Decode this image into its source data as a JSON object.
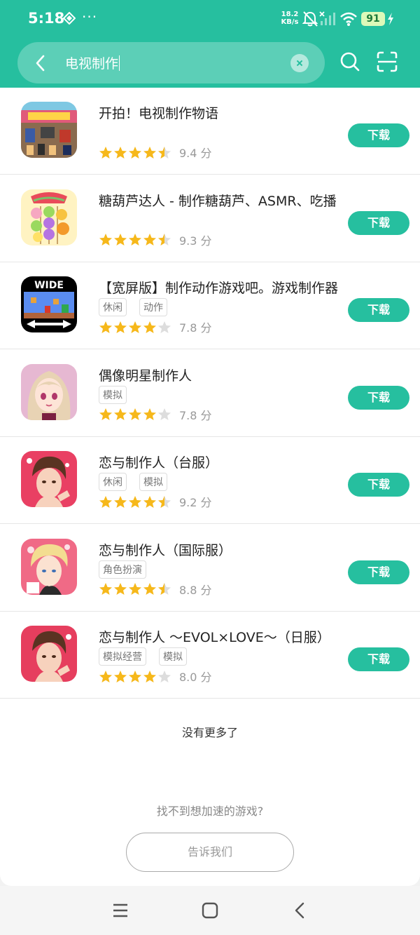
{
  "status_bar": {
    "time": "5:18",
    "dots": "···",
    "speed_value": "18.2",
    "speed_unit": "KB/s",
    "battery": "91"
  },
  "search": {
    "query": "电视制作"
  },
  "theme": {
    "accent": "#26bf9f",
    "star": "#f6b81b",
    "star_empty": "#dddddd"
  },
  "apps": [
    {
      "title": "开拍！电视制作物语",
      "tags": [],
      "rating": 4.5,
      "score": "9.4 分",
      "button": "下载",
      "icon": "tv-studio-game-icon"
    },
    {
      "title": "糖葫芦达人 - 制作糖葫芦、ASMR、吃播",
      "tags": [],
      "rating": 4.5,
      "score": "9.3 分",
      "button": "下载",
      "icon": "candied-fruit-icon"
    },
    {
      "title": "【宽屏版】制作动作游戏吧。游戏制作器",
      "tags": [
        "休闲",
        "动作"
      ],
      "rating": 4,
      "score": "7.8 分",
      "button": "下载",
      "icon": "wide-game-maker-icon"
    },
    {
      "title": "偶像明星制作人",
      "tags": [
        "模拟"
      ],
      "rating": 4,
      "score": "7.8 分",
      "button": "下载",
      "icon": "idol-producer-icon"
    },
    {
      "title": "恋与制作人（台服）",
      "tags": [
        "休闲",
        "模拟"
      ],
      "rating": 4.5,
      "score": "9.2 分",
      "button": "下载",
      "icon": "love-producer-tw-icon"
    },
    {
      "title": "恋与制作人（国际服）",
      "tags": [
        "角色扮演"
      ],
      "rating": 4.5,
      "score": "8.8 分",
      "button": "下载",
      "icon": "love-producer-intl-icon"
    },
    {
      "title": "恋与制作人 ～EVOL×LOVE～（日服）",
      "tags": [
        "模拟经营",
        "模拟"
      ],
      "rating": 4,
      "score": "8.0 分",
      "button": "下载",
      "icon": "love-producer-jp-icon"
    }
  ],
  "footer": {
    "no_more": "没有更多了",
    "cant_find": "找不到想加速的游戏?",
    "tell_us": "告诉我们"
  },
  "nav": {
    "icons": [
      "menu-icon",
      "home-icon",
      "back-icon"
    ]
  }
}
